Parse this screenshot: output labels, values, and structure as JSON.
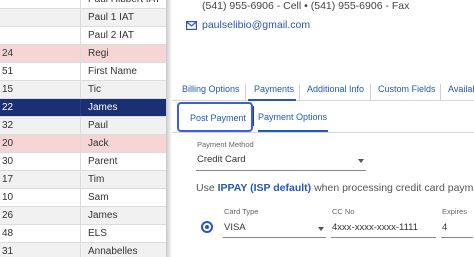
{
  "grid": {
    "rows": [
      {
        "id": "",
        "name": "Paul Hibbert IAT",
        "style": "white"
      },
      {
        "id": "",
        "name": "Paul 1 IAT",
        "style": "grey"
      },
      {
        "id": "",
        "name": "Paul 2 IAT",
        "style": "white"
      },
      {
        "id": "24",
        "name": "Regi",
        "style": "pink"
      },
      {
        "id": "51",
        "name": "First Name",
        "style": "white"
      },
      {
        "id": "15",
        "name": "Tic",
        "style": "grey"
      },
      {
        "id": "22",
        "name": "James",
        "style": "selected"
      },
      {
        "id": "32",
        "name": "Paul",
        "style": "grey"
      },
      {
        "id": "20",
        "name": "Jack",
        "style": "pink"
      },
      {
        "id": "30",
        "name": "Parent",
        "style": "white"
      },
      {
        "id": "17",
        "name": "Tim",
        "style": "grey"
      },
      {
        "id": "10",
        "name": "Sam",
        "style": "white"
      },
      {
        "id": "26",
        "name": "James",
        "style": "grey"
      },
      {
        "id": "48",
        "name": "ELS",
        "style": "white"
      },
      {
        "id": "31",
        "name": "Annabelles",
        "style": "grey"
      }
    ]
  },
  "contact": {
    "phones": "(541) 955-6906 - Cell  •  (541) 955-6906 - Fax",
    "email": "paulselibio@gmail.com"
  },
  "tabs": [
    "Billing Options",
    "Payments",
    "Additional Info",
    "Custom Fields",
    "Availability"
  ],
  "active_tab": "Payments",
  "subtabs": {
    "post": "Post Payment",
    "options": "Payment Options"
  },
  "payment_method": {
    "label": "Payment Method",
    "value": "Credit Card"
  },
  "use_line": {
    "prefix": "Use ",
    "highlight": "IPPAY (ISP default)",
    "suffix": " when processing credit card payments for this"
  },
  "card_fields": {
    "card_type_label": "Card Type",
    "card_type_value": "VISA",
    "cc_no_label": "CC No",
    "cc_no_value": "4xxx-xxxx-xxxx-1111",
    "expires_label": "Expires",
    "expires_value": "4"
  },
  "colors": {
    "accent": "#2459b4",
    "selected_row": "#1b2f74",
    "pink_row": "#f6d5d5"
  }
}
